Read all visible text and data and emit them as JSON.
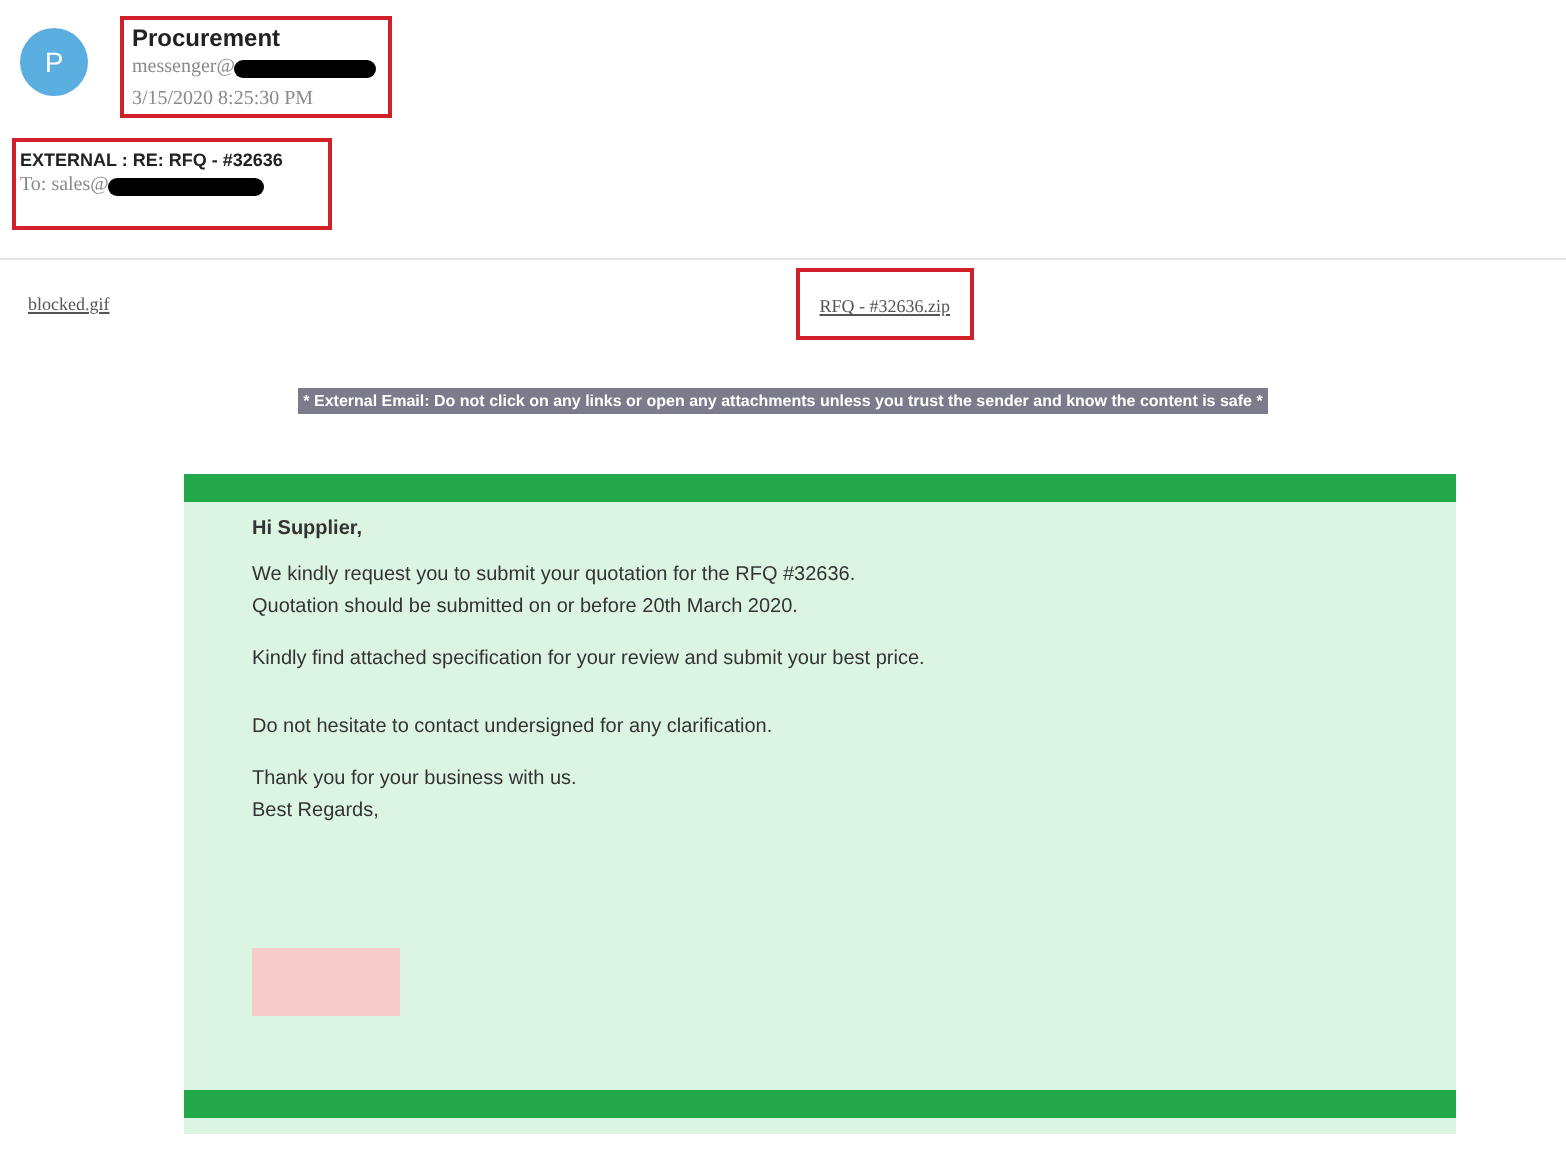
{
  "sender": {
    "avatar_letter": "P",
    "name": "Procurement",
    "address": "messenger@",
    "date": "3/15/2020 8:25:30 PM"
  },
  "subject": "EXTERNAL : RE: RFQ - #32636",
  "recipient": "To: sales@",
  "attachments": [
    "blocked.gif",
    "RFQ - #32636.zip"
  ],
  "warning_banner": "* External Email: Do not click on any links or open any attachments unless you trust the sender and know the content is safe *",
  "body": {
    "greeting": "Hi Supplier,",
    "paragraphs": [
      [
        "We kindly request you to submit your quotation for the RFQ #32636.",
        "Quotation should be submitted on or before 20th March 2020."
      ],
      [
        "Kindly find attached specification for your review and submit your best price."
      ],
      [
        "Do not hesitate to contact undersigned for any clarification."
      ],
      [
        "Thank you for your business with us.",
        "Best Regards,"
      ]
    ]
  }
}
